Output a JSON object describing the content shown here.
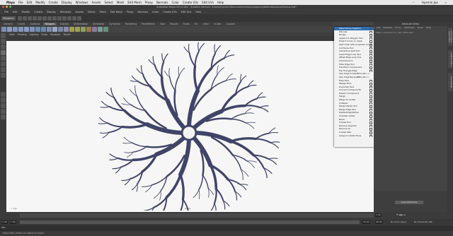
{
  "mac_menubar": {
    "app_name": "Maya",
    "items": [
      "File",
      "Edit",
      "Modify",
      "Create",
      "Display",
      "Windows",
      "Assets",
      "Select",
      "Mesh",
      "Edit Mesh",
      "Proxy",
      "Normals",
      "Color",
      "Create UVs",
      "Edit UVs",
      "Help"
    ],
    "clock": "Hyemin Jue"
  },
  "window_title": "Autodesk Maya 2014 x64 - Student Version: /Users/hyemin/Documents/maya/projects/default/scenes/ferdus.ma*",
  "status_line": {
    "menu_set": "Polygons"
  },
  "shelf": {
    "tabs": [
      "General",
      "Curves",
      "Surfaces",
      "Polygons",
      "Subdivs",
      "Deformation",
      "Animation",
      "Dynamics",
      "Rendering",
      "PaintEffects",
      "Toon",
      "Muscle",
      "Fluids",
      "Fur",
      "nHair",
      "nCloth",
      "Custom"
    ],
    "active_tab": "Polygons"
  },
  "viewport": {
    "menu": [
      "View",
      "Shading",
      "Lighting",
      "Show",
      "Renderer",
      "Panels"
    ],
    "camera_label": "persp",
    "model_color": "#3f4468",
    "background": "#f6f6f6"
  },
  "marking_menu": {
    "items": [
      "Make Pieces Together",
      "Extrude",
      "Bridge",
      "Append to Polygon Tool",
      "Project Curve on mesh",
      "Split mesh with projected curve",
      "Cut Faces Tool",
      "Interactive Split Tool",
      "Insert Edge Loop Tool",
      "Offset Edge Loop Tool",
      "Add Divisions",
      "Slide Edge Tool",
      "Transform Component",
      "Flip Triangle Edge",
      "Spin Edge Forward",
      "Spin Edge Backward",
      "Poke Face",
      "Wedge Face",
      "Duplicate Face",
      "Connect Components",
      "Detach Component",
      "Merge",
      "Merge To Center",
      "Collapse",
      "Merge Vertex Tool",
      "Merge Edge Tool",
      "Delete Edge/Vertex",
      "Chamfer Vertex",
      "Bevel",
      "Crease Tool",
      "Remove selected",
      "Remove all",
      "Crease Sets",
      "Assign Invisible Faces"
    ],
    "selected_index": 0,
    "shortcuts": {
      "14": "Ctrl+Alt+->",
      "15": "Ctrl+Alt+<-"
    }
  },
  "attribute_editor": {
    "title": "Attribute Editor",
    "menu": [
      "List",
      "Selected",
      "Focus",
      "Attributes",
      "Show",
      "Help"
    ],
    "message": "Make a selection to view attributes",
    "select_button": "Load Attributes"
  },
  "side_tabs": [
    "Channel Box / Layer Editor",
    "Attribute Editor",
    "Tool Settings"
  ],
  "time": {
    "start": "1.00",
    "end": "24.00",
    "range_start": "1.00",
    "range_end": "48.00",
    "current": "1.00",
    "anim_layer": "No Anim Layer",
    "char_set": "No Character Set"
  },
  "help_line": "Move Tool: Select an object to move."
}
